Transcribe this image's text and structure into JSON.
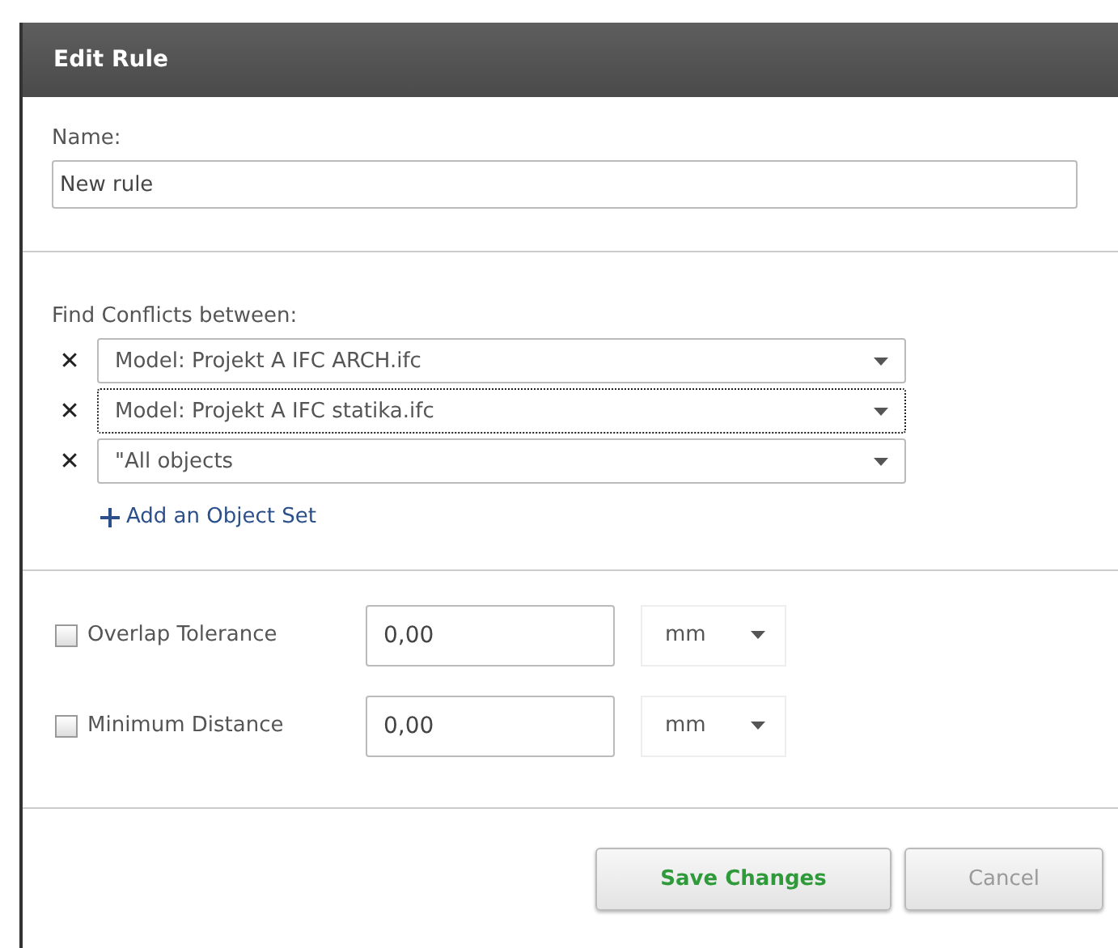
{
  "dialog": {
    "title": "Edit Rule"
  },
  "name": {
    "label": "Name:",
    "value": "New rule"
  },
  "conflicts": {
    "label": "Find Conflicts between:",
    "sets": [
      {
        "remove": "✕",
        "value": "Model: Projekt A IFC ARCH.ifc",
        "focused": false
      },
      {
        "remove": "✕",
        "value": "Model: Projekt A IFC statika.ifc",
        "focused": true
      },
      {
        "remove": "✕",
        "value": "\"All objects",
        "focused": false
      }
    ],
    "add_link": "Add an Object Set"
  },
  "options": [
    {
      "label": "Overlap Tolerance",
      "checked": false,
      "value": "0,00",
      "unit": "mm"
    },
    {
      "label": "Minimum Distance",
      "checked": false,
      "value": "0,00",
      "unit": "mm"
    }
  ],
  "buttons": [
    {
      "label": "Save Changes",
      "kind": "primary"
    },
    {
      "label": "Cancel",
      "kind": "secondary"
    }
  ]
}
